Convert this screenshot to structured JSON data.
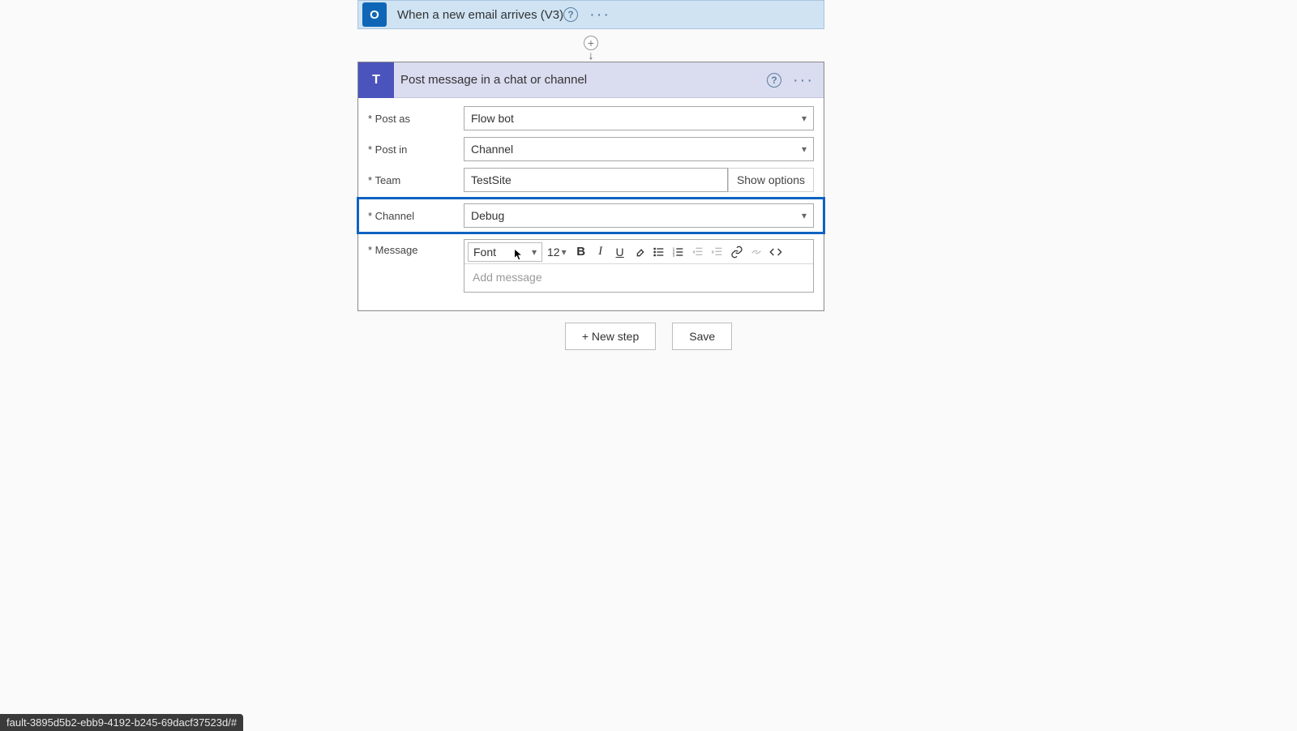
{
  "trigger": {
    "title": "When a new email arrives (V3)",
    "icon_letter": "O"
  },
  "action": {
    "title": "Post message in a chat or channel",
    "icon_letter": "T"
  },
  "form": {
    "post_as_label": "Post as",
    "post_as_value": "Flow bot",
    "post_in_label": "Post in",
    "post_in_value": "Channel",
    "team_label": "Team",
    "team_value": "TestSite",
    "show_options_label": "Show options",
    "channel_label": "Channel",
    "channel_value": "Debug",
    "message_label": "Message",
    "message_placeholder": "Add message"
  },
  "toolbar": {
    "font_label": "Font",
    "size_label": "12"
  },
  "footer": {
    "new_step_label": "+ New step",
    "save_label": "Save"
  },
  "status_text": "fault-3895d5b2-ebb9-4192-b245-69dacf37523d/#"
}
